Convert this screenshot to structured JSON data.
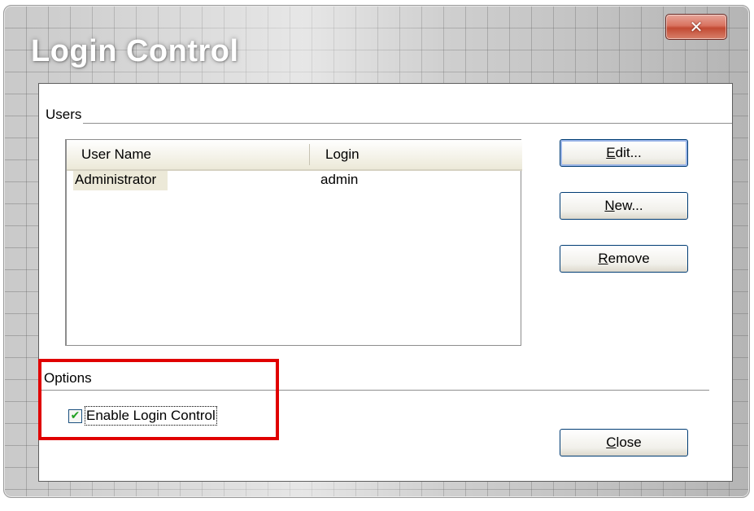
{
  "window": {
    "title": "Login Control",
    "close_glyph": "✕"
  },
  "users_group": {
    "label": "Users",
    "columns": [
      "User Name",
      "Login"
    ],
    "rows": [
      {
        "user_name": "Administrator",
        "login": "admin"
      }
    ]
  },
  "buttons": {
    "edit": {
      "hotkey": "E",
      "rest": "dit..."
    },
    "new": {
      "hotkey": "N",
      "rest": "ew..."
    },
    "remove": {
      "hotkey": "R",
      "rest": "emove"
    },
    "close": {
      "hotkey": "C",
      "rest": "lose"
    }
  },
  "options_group": {
    "label": "Options",
    "enable_login_control": {
      "label": "Enable Login Control",
      "checked": true,
      "check_glyph": "✔"
    }
  },
  "colors": {
    "highlight_box": "#e00000",
    "close_button": "#c24a33",
    "checkmark": "#21a121"
  }
}
